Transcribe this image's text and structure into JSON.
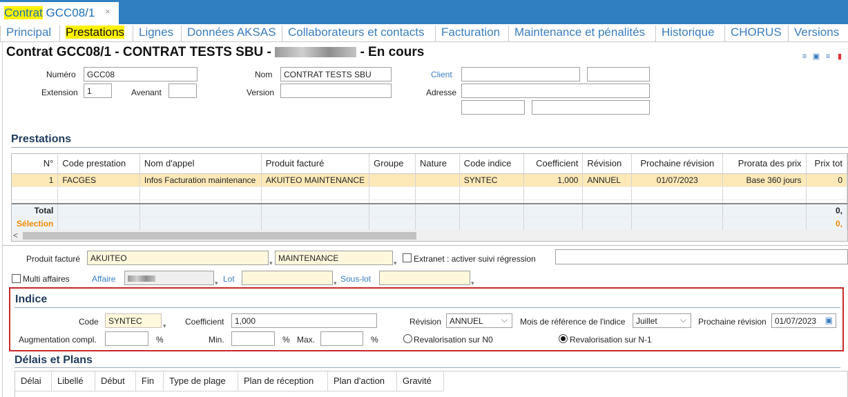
{
  "document_tab": {
    "prefix": "Contrat",
    "code": "GCC08/1",
    "close": "×"
  },
  "subtabs": [
    "Principal",
    "Prestations",
    "Lignes",
    "Données AKSAS",
    "Collaborateurs et contacts",
    "Facturation",
    "Maintenance et pénalités",
    "Historique",
    "CHORUS",
    "Versions"
  ],
  "title": {
    "left": "Contrat  GCC08/1 - CONTRAT TESTS SBU -",
    "right": "- En cours"
  },
  "toolbar_icons": [
    "add-list-icon",
    "save-icon",
    "check-list-icon",
    "delete-icon"
  ],
  "header": {
    "numero_label": "Numéro",
    "numero": "GCC08",
    "extension_label": "Extension",
    "extension": "1",
    "avenant_label": "Avenant",
    "avenant": "",
    "nom_label": "Nom",
    "nom": "CONTRAT TESTS SBU",
    "version_label": "Version",
    "version": "",
    "client_label": "Client",
    "adresse_label": "Adresse"
  },
  "prestations": {
    "title": "Prestations",
    "columns": [
      "N°",
      "Code prestation",
      "Nom d'appel",
      "Produit facturé",
      "Groupe",
      "Nature",
      "Code indice",
      "Coefficient",
      "Révision",
      "Prochaine révision",
      "Prorata des prix",
      "Prix tot"
    ],
    "rows": [
      [
        "1",
        "FACGES",
        "Infos Facturation maintenance",
        "AKUITEO MAINTENANCE",
        "",
        "",
        "SYNTEC",
        "1,000",
        "ANNUEL",
        "01/07/2023",
        "Base 360 jours",
        "0"
      ]
    ],
    "total_label": "Total",
    "total_value": "0,",
    "selection_label": "Sélection",
    "selection_value": "0,",
    "scroll_left": "<"
  },
  "produit": {
    "label": "Produit facturé",
    "value1": "AKUITEO",
    "value2": "MAINTENANCE",
    "extranet_label": "Extranet : activer suivi régression",
    "multi_label": "Multi affaires",
    "affaire_label": "Affaire",
    "lot_label": "Lot",
    "souslot_label": "Sous-lot"
  },
  "indice": {
    "title": "Indice",
    "code_label": "Code",
    "code": "SYNTEC",
    "coef_label": "Coefficient",
    "coef": "1,000",
    "revision_label": "Révision",
    "revision": "ANNUEL",
    "mois_label": "Mois de référence de l'indice",
    "mois": "Juillet",
    "prochaine_label": "Prochaine révision",
    "prochaine": "01/07/2023",
    "augm_label": "Augmentation compl.",
    "pct": "%",
    "min_label": "Min.",
    "max_label": "Max.",
    "reval_n0": "Revalorisation sur N0",
    "reval_n1": "Revalorisation sur N-1"
  },
  "delais": {
    "title": "Délais et Plans",
    "columns": [
      "Délai",
      "Libellé",
      "Début",
      "Fin",
      "Type de plage",
      "Plan de réception",
      "Plan d'action",
      "Gravité"
    ]
  }
}
